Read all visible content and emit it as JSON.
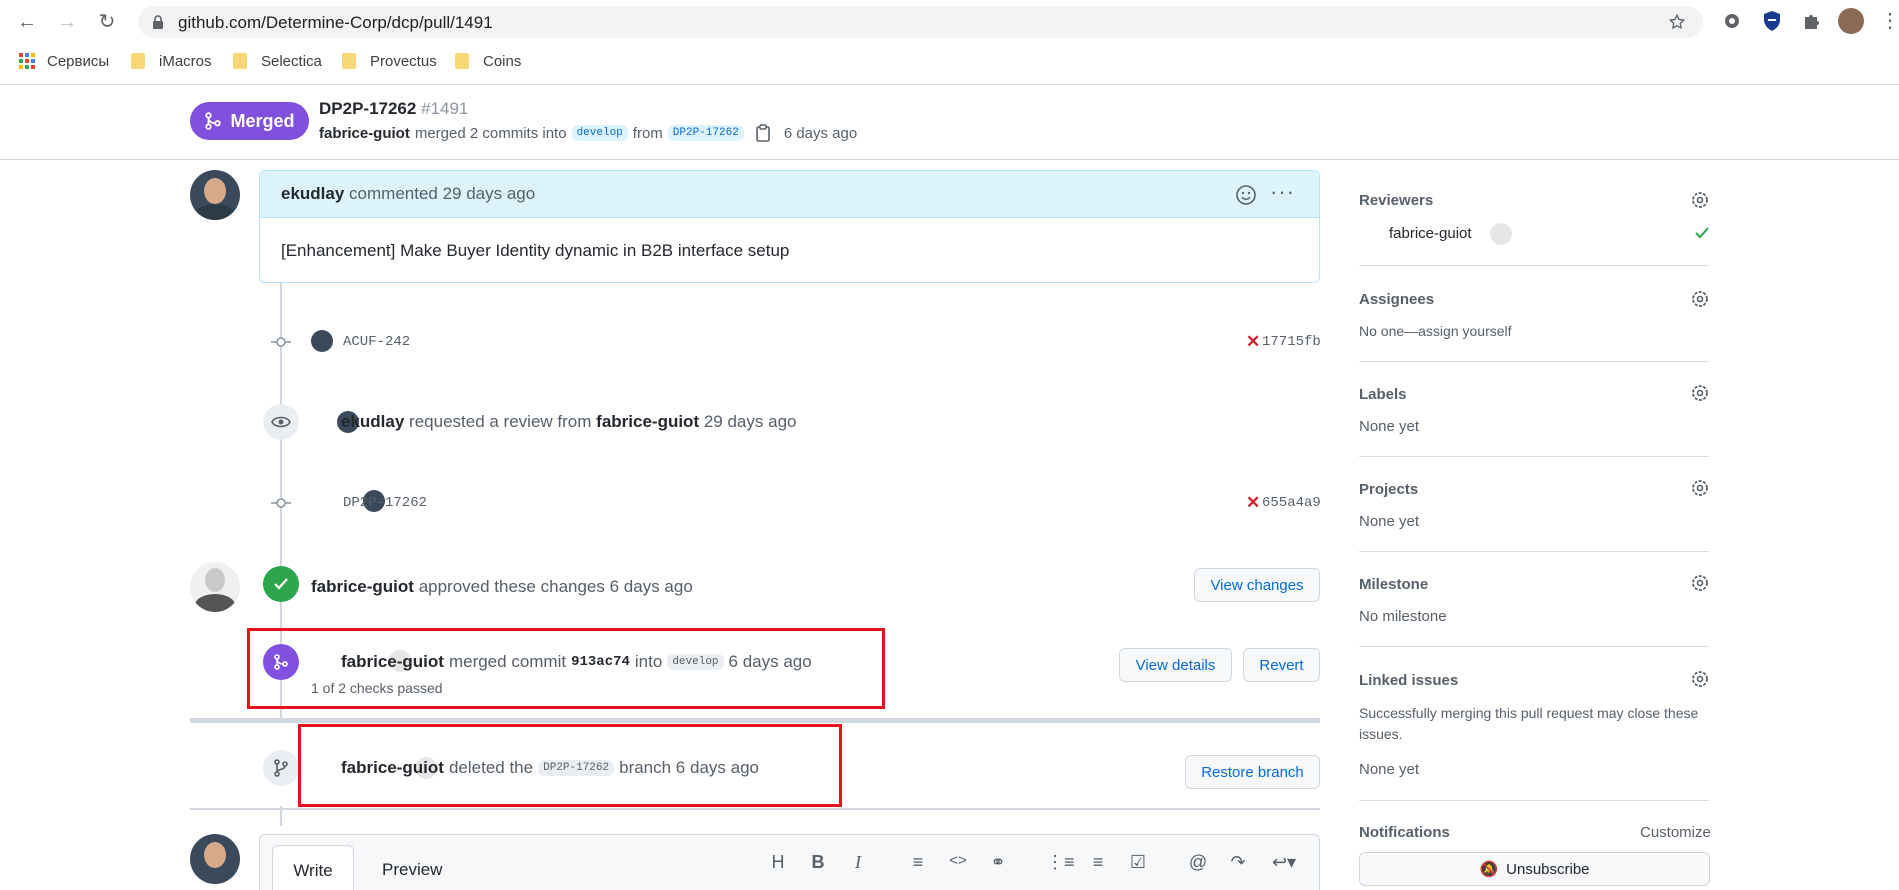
{
  "browser": {
    "url": "github.com/Determine-Corp/dcp/pull/1491",
    "bookmarks": [
      {
        "label": "Сервисы",
        "icon": "apps-grid-icon"
      },
      {
        "label": "iMacros",
        "icon": "folder-icon"
      },
      {
        "label": "Selectica",
        "icon": "folder-icon"
      },
      {
        "label": "Provectus",
        "icon": "folder-icon"
      },
      {
        "label": "Coins",
        "icon": "folder-icon"
      }
    ]
  },
  "pr": {
    "state_label": "Merged",
    "title": "DP2P-17262",
    "number": "#1491",
    "author": "fabrice-guiot",
    "merge_text": "merged 2 commits into",
    "base_branch": "develop",
    "from_text": "from",
    "head_branch": "DP2P-17262",
    "time": "6 days ago"
  },
  "comment": {
    "author": "ekudlay",
    "meta": "commented 29 days ago",
    "body": "[Enhancement] Make Buyer Identity dynamic in B2B interface setup"
  },
  "timeline": {
    "commit1": {
      "message": "ACUF-242",
      "sha": "17715fb"
    },
    "review_request": {
      "actor": "ekudlay",
      "text": "requested a review from",
      "reviewer": "fabrice-guiot",
      "time": "29 days ago"
    },
    "commit2": {
      "message": "DP2P-17262",
      "sha": "655a4a9"
    },
    "approval": {
      "actor": "fabrice-guiot",
      "text": "approved these changes 6 days ago",
      "button": "View changes"
    },
    "merge": {
      "actor": "fabrice-guiot",
      "text": "merged commit",
      "sha": "913ac74",
      "into": "into",
      "branch": "develop",
      "time": "6 days ago",
      "checks": "1 of 2 checks passed",
      "details_button": "View details",
      "revert_button": "Revert"
    },
    "delete": {
      "actor": "fabrice-guiot",
      "text": "deleted the",
      "branch": "DP2P-17262",
      "suffix": "branch 6 days ago",
      "button": "Restore branch"
    }
  },
  "editor": {
    "tabs": [
      "Write",
      "Preview"
    ]
  },
  "sidebar": {
    "reviewers": {
      "title": "Reviewers",
      "value": "fabrice-guiot"
    },
    "assignees": {
      "title": "Assignees",
      "value": "No one—assign yourself"
    },
    "labels": {
      "title": "Labels",
      "value": "None yet"
    },
    "projects": {
      "title": "Projects",
      "value": "None yet"
    },
    "milestone": {
      "title": "Milestone",
      "value": "No milestone"
    },
    "linked_issues": {
      "title": "Linked issues",
      "desc": "Successfully merging this pull request may close these issues.",
      "value": "None yet"
    },
    "notifications": {
      "title": "Notifications",
      "customize": "Customize",
      "button": "Unsubscribe"
    }
  },
  "colors": {
    "merged_purple": "#8250df",
    "approved_green": "#2da44e",
    "link_blue": "#0969da",
    "fail_red": "#cf222e",
    "highlight_box": "#e5141c"
  }
}
